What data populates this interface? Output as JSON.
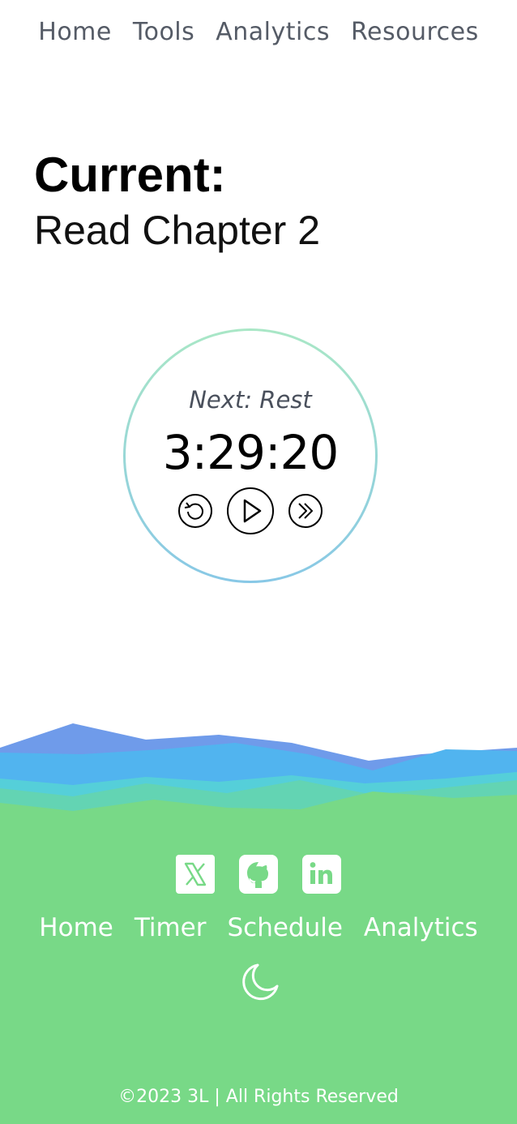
{
  "nav": {
    "items": [
      "Home",
      "Tools",
      "Analytics",
      "Resources"
    ]
  },
  "current": {
    "label": "Current:",
    "task": "Read Chapter 2"
  },
  "timer": {
    "next_label": "Next: Rest",
    "time": "3:29:20",
    "controls": [
      "restart-icon",
      "play-icon",
      "skip-forward-icon"
    ]
  },
  "footer": {
    "social": [
      "x-icon",
      "github-icon",
      "linkedin-icon"
    ],
    "nav_items": [
      "Home",
      "Timer",
      "Schedule",
      "Analytics"
    ],
    "theme_toggle_icon": "moon-icon",
    "copyright": "©2023 3L | All Rights Reserved"
  },
  "colors": {
    "footer_bg": "#78d987",
    "ring_top": "#a9e7c6",
    "ring_bottom": "#88c8e6",
    "nav_text": "#555b66"
  }
}
